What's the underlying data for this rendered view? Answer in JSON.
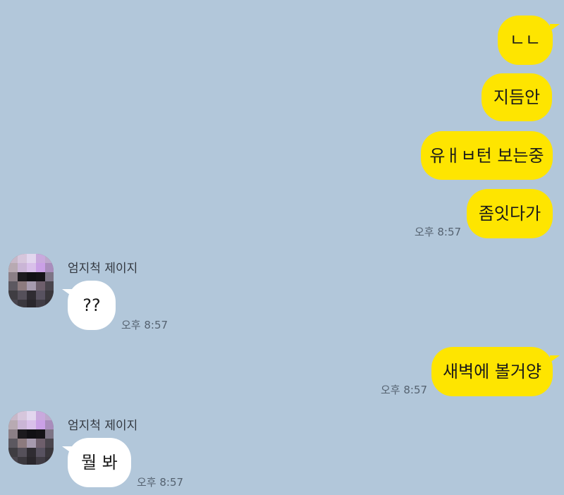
{
  "chat": {
    "messages": [
      {
        "text": "ㄴㄴ"
      },
      {
        "text": "지듬안"
      },
      {
        "text": "유ㅐㅂ턴 보는중"
      },
      {
        "text": "좀잇다가"
      },
      {
        "text": "??"
      },
      {
        "text": "새벽에 볼거양"
      },
      {
        "text": "뭘 봐"
      }
    ],
    "timestamps": [
      "오후 8:57",
      "오후 8:57",
      "오후 8:57",
      "오후 8:57"
    ],
    "sender_name": "엄지척 제이지",
    "avatar_icon": "pixelated-profile-icon",
    "colors": {
      "background": "#b2c7da",
      "my_bubble": "#fee500",
      "their_bubble": "#ffffff"
    }
  }
}
